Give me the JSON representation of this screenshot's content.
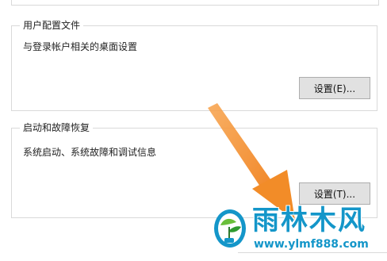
{
  "user_profiles": {
    "title": "用户配置文件",
    "description": "与登录帐户相关的桌面设置",
    "settings_button": "设置(E)..."
  },
  "startup_recovery": {
    "title": "启动和故障恢复",
    "description": "系统启动、系统故障和调试信息",
    "settings_button": "设置(T)..."
  },
  "watermark": {
    "name": "雨林木风",
    "url": "www.ylmf888.com",
    "color": "#1496c9"
  },
  "annotation": {
    "arrow_color": "#f28c28",
    "arrow_icon": "orange-arrow-icon"
  }
}
